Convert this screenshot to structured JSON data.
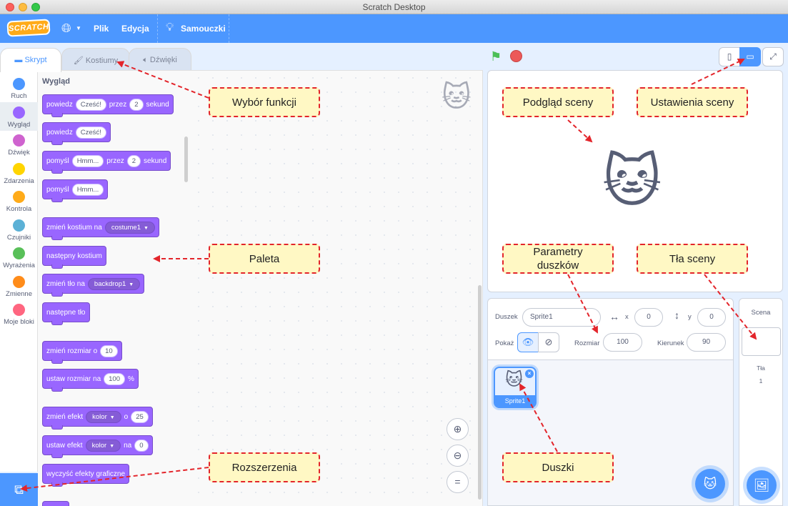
{
  "window": {
    "title": "Scratch Desktop"
  },
  "menubar": {
    "logo": "SCRATCH",
    "file": "Plik",
    "edit": "Edycja",
    "tutorials": "Samouczki"
  },
  "tabs": {
    "code": "Skrypt",
    "costumes": "Kostiumy",
    "sounds": "Dźwięki"
  },
  "categories": [
    {
      "label": "Ruch",
      "color": "#4c97ff"
    },
    {
      "label": "Wygląd",
      "color": "#9966ff"
    },
    {
      "label": "Dźwięk",
      "color": "#cf63cf"
    },
    {
      "label": "Zdarzenia",
      "color": "#ffd500"
    },
    {
      "label": "Kontrola",
      "color": "#ffab19"
    },
    {
      "label": "Czujniki",
      "color": "#5cb1d6"
    },
    {
      "label": "Wyrażenia",
      "color": "#59c059"
    },
    {
      "label": "Zmienne",
      "color": "#ff8c1a"
    },
    {
      "label": "Moje bloki",
      "color": "#ff6680"
    }
  ],
  "palette": {
    "title": "Wygląd",
    "blocks": {
      "b1": {
        "t1": "powiedz",
        "v1": "Cześć!",
        "t2": "przez",
        "v2": "2",
        "t3": "sekund"
      },
      "b2": {
        "t1": "powiedz",
        "v1": "Cześć!"
      },
      "b3": {
        "t1": "pomyśl",
        "v1": "Hmm...",
        "t2": "przez",
        "v2": "2",
        "t3": "sekund"
      },
      "b4": {
        "t1": "pomyśl",
        "v1": "Hmm..."
      },
      "b5": {
        "t1": "zmień kostium na",
        "d1": "costume1"
      },
      "b6": {
        "t1": "następny kostium"
      },
      "b7": {
        "t1": "zmień tło na",
        "d1": "backdrop1"
      },
      "b8": {
        "t1": "następne tło"
      },
      "b9": {
        "t1": "zmień rozmiar o",
        "v1": "10"
      },
      "b10": {
        "t1": "ustaw rozmiar na",
        "v1": "100",
        "t2": "%"
      },
      "b11": {
        "t1": "zmień efekt",
        "d1": "kolor",
        "t2": "o",
        "v1": "25"
      },
      "b12": {
        "t1": "ustaw efekt",
        "d1": "kolor",
        "t2": "na",
        "v1": "0"
      },
      "b13": {
        "t1": "wyczyść efekty graficzne"
      }
    }
  },
  "sprite_info": {
    "sprite_label": "Duszek",
    "sprite_name": "Sprite1",
    "x_label": "x",
    "x_value": "0",
    "y_label": "y",
    "y_value": "0",
    "show_label": "Pokaż",
    "size_label": "Rozmiar",
    "size_value": "100",
    "direction_label": "Kierunek",
    "direction_value": "90"
  },
  "sprites": [
    {
      "name": "Sprite1"
    }
  ],
  "scene": {
    "title": "Scena",
    "backdrops_label": "Tła",
    "backdrops_count": "1"
  },
  "annotations": {
    "functions": "Wybór funkcji",
    "preview": "Podgląd sceny",
    "settings": "Ustawienia sceny",
    "palette": "Paleta",
    "params": "Parametry duszków",
    "backdrops": "Tła sceny",
    "extensions": "Rozszerzenia",
    "sprites": "Duszki"
  },
  "icons": {
    "globe": "globe-icon",
    "bulb": "lightbulb-icon",
    "flag": "green-flag-icon",
    "stop": "stop-icon",
    "cat": "scratch-cat"
  }
}
